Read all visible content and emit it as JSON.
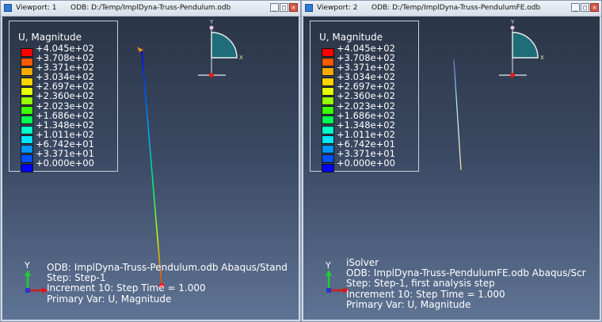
{
  "colors": {
    "accent_blue": "#2e7bd6",
    "close_red": "#d65a4a"
  },
  "viewport1": {
    "title": "Viewport: 1",
    "odb_title": "ODB: D:/Temp/ImplDyna-Truss-Pendulum.odb",
    "legend": {
      "title": "U, Magnitude",
      "values": [
        "+4.045e+02",
        "+3.708e+02",
        "+3.371e+02",
        "+3.034e+02",
        "+2.697e+02",
        "+2.360e+02",
        "+2.023e+02",
        "+1.686e+02",
        "+1.348e+02",
        "+1.011e+02",
        "+6.742e+01",
        "+3.371e+01",
        "+0.000e+00"
      ],
      "colors": [
        "#ff0000",
        "#ff5a00",
        "#ffaa00",
        "#ffd400",
        "#e6ff00",
        "#96ff00",
        "#3cff00",
        "#00ff50",
        "#00ffc8",
        "#00e6ff",
        "#0096ff",
        "#0050ff",
        "#0000ff"
      ]
    },
    "triad": {
      "y": "Y",
      "x": "X",
      "z": "Z"
    },
    "orientation": {
      "y": "Y",
      "x": "X"
    },
    "info_lines": [
      "ODB: ImplDyna-Truss-Pendulum.odb     Abaqus/Stand",
      "Step: Step-1",
      "Increment      10: Step Time =      1.000",
      "Primary Var: U, Magnitude"
    ]
  },
  "viewport2": {
    "title": "Viewport: 2",
    "odb_title": "ODB: D:/Temp/ImplDyna-Truss-PendulumFE.odb",
    "legend": {
      "title": "U, Magnitude",
      "values": [
        "+4.045e+02",
        "+3.708e+02",
        "+3.371e+02",
        "+3.034e+02",
        "+2.697e+02",
        "+2.360e+02",
        "+2.023e+02",
        "+1.686e+02",
        "+1.348e+02",
        "+1.011e+02",
        "+6.742e+01",
        "+3.371e+01",
        "+0.000e+00"
      ],
      "colors": [
        "#ff0000",
        "#ff5a00",
        "#ffaa00",
        "#ffd400",
        "#e6ff00",
        "#96ff00",
        "#3cff00",
        "#00ff50",
        "#00ffc8",
        "#00e6ff",
        "#0096ff",
        "#0050ff",
        "#0000ff"
      ]
    },
    "triad": {
      "y": "Y",
      "x": "X",
      "z": "Z"
    },
    "orientation": {
      "y": "Y",
      "x": "X"
    },
    "info_lines": [
      "iSolver",
      "ODB: ImplDyna-Truss-PendulumFE.odb     Abaqus/Scr",
      "Step: Step-1, first analysis step",
      "Increment      10: Step Time =      1.000",
      "Primary Var: U, Magnitude"
    ]
  },
  "window_buttons": {
    "minimize": "_",
    "maximize": "□",
    "close": "×"
  }
}
